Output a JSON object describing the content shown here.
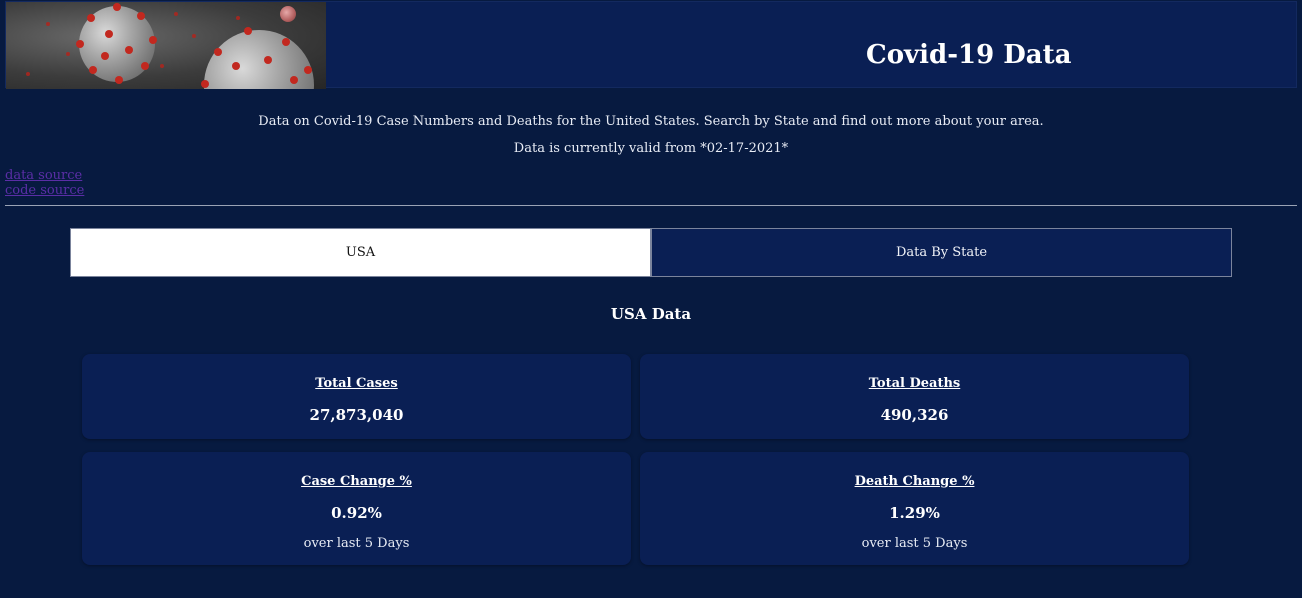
{
  "header": {
    "title": "Covid-19 Data"
  },
  "intro": {
    "description": "Data on Covid-19 Case Numbers and Deaths for the United States. Search by State and find out more about your area.",
    "valid_from": "Data is currently valid from *02-17-2021*"
  },
  "links": {
    "data_source": "data source",
    "code_source": "code source"
  },
  "tabs": [
    {
      "label": "USA",
      "active": true
    },
    {
      "label": "Data By State",
      "active": false
    }
  ],
  "section": {
    "title": "USA Data"
  },
  "stats": {
    "total_cases": {
      "label": "Total Cases",
      "value": "27,873,040"
    },
    "total_deaths": {
      "label": "Total Deaths",
      "value": "490,326"
    },
    "case_change": {
      "label": "Case Change %",
      "value": "0.92%",
      "note": "over last 5 Days"
    },
    "death_change": {
      "label": "Death Change %",
      "value": "1.29%",
      "note": "over last 5 Days"
    }
  },
  "colors": {
    "background": "#071a40",
    "panel": "#0a1f54",
    "virus_spike": "#c2281f",
    "link": "#5a2ea6"
  }
}
